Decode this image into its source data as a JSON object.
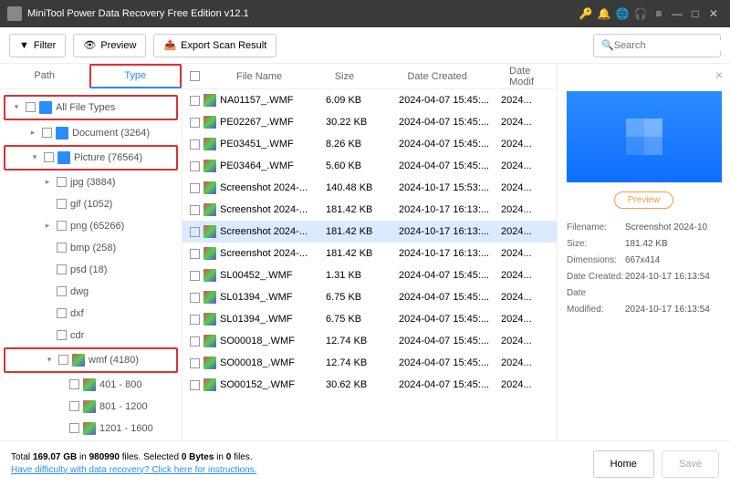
{
  "window": {
    "title": "MiniTool Power Data Recovery Free Edition v12.1"
  },
  "toolbar": {
    "filter": "Filter",
    "preview": "Preview",
    "export": "Export Scan Result",
    "search_placeholder": "Search"
  },
  "sidebar": {
    "tabs": {
      "path": "Path",
      "type": "Type"
    },
    "nodes": {
      "all": "All File Types",
      "document": "Document (3264)",
      "picture": "Picture (76564)",
      "jpg": "jpg (3884)",
      "gif": "gif (1052)",
      "png": "png (65266)",
      "bmp": "bmp (258)",
      "psd": "psd (18)",
      "dwg": "dwg",
      "dxf": "dxf",
      "cdr": "cdr",
      "wmf": "wmf (4180)",
      "r1": "401 - 800",
      "r2": "801 - 1200",
      "r3": "1201 - 1600"
    }
  },
  "list": {
    "headers": {
      "name": "File Name",
      "size": "Size",
      "created": "Date Created",
      "modified": "Date Modif"
    },
    "rows": [
      {
        "name": "NA01157_.WMF",
        "size": "6.09 KB",
        "created": "2024-04-07 15:45:...",
        "modified": "2024..."
      },
      {
        "name": "PE02267_.WMF",
        "size": "30.22 KB",
        "created": "2024-04-07 15:45:...",
        "modified": "2024..."
      },
      {
        "name": "PE03451_.WMF",
        "size": "8.26 KB",
        "created": "2024-04-07 15:45:...",
        "modified": "2024..."
      },
      {
        "name": "PE03464_.WMF",
        "size": "5.60 KB",
        "created": "2024-04-07 15:45:...",
        "modified": "2024..."
      },
      {
        "name": "Screenshot 2024-...",
        "size": "140.48 KB",
        "created": "2024-10-17 15:53:...",
        "modified": "2024..."
      },
      {
        "name": "Screenshot 2024-...",
        "size": "181.42 KB",
        "created": "2024-10-17 16:13:...",
        "modified": "2024..."
      },
      {
        "name": "Screenshot 2024-...",
        "size": "181.42 KB",
        "created": "2024-10-17 16:13:...",
        "modified": "2024...",
        "selected": true
      },
      {
        "name": "Screenshot 2024-...",
        "size": "181.42 KB",
        "created": "2024-10-17 16:13:...",
        "modified": "2024..."
      },
      {
        "name": "SL00452_.WMF",
        "size": "1.31 KB",
        "created": "2024-04-07 15:45:...",
        "modified": "2024..."
      },
      {
        "name": "SL01394_.WMF",
        "size": "6.75 KB",
        "created": "2024-04-07 15:45:...",
        "modified": "2024..."
      },
      {
        "name": "SL01394_.WMF",
        "size": "6.75 KB",
        "created": "2024-04-07 15:45:...",
        "modified": "2024..."
      },
      {
        "name": "SO00018_.WMF",
        "size": "12.74 KB",
        "created": "2024-04-07 15:45:...",
        "modified": "2024..."
      },
      {
        "name": "SO00018_.WMF",
        "size": "12.74 KB",
        "created": "2024-04-07 15:45:...",
        "modified": "2024..."
      },
      {
        "name": "SO00152_.WMF",
        "size": "30.62 KB",
        "created": "2024-04-07 15:45:...",
        "modified": "2024..."
      }
    ]
  },
  "preview": {
    "button": "Preview",
    "labels": {
      "filename": "Filename:",
      "size": "Size:",
      "dim": "Dimensions:",
      "created": "Date Created:",
      "modified": "Date Modified:"
    },
    "values": {
      "filename": "Screenshot 2024-10",
      "size": "181.42 KB",
      "dim": "667x414",
      "created": "2024-10-17 16:13:54",
      "modified": "2024-10-17 16:13:54"
    }
  },
  "footer": {
    "total_a": "Total ",
    "total_b": "169.07 GB",
    "total_c": " in ",
    "total_d": "980990",
    "total_e": " files.  Selected ",
    "total_f": "0 Bytes",
    "total_g": " in ",
    "total_h": "0",
    "total_i": " files.",
    "link": "Have difficulty with data recovery? Click here for instructions.",
    "home": "Home",
    "save": "Save"
  }
}
